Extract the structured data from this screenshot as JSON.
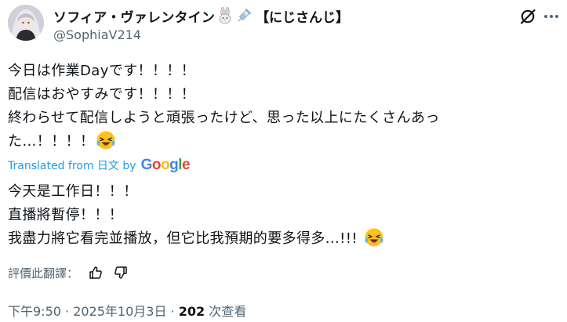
{
  "author": {
    "name": "ソフィア・ヴァレンタイン",
    "emoji_icons": [
      "rabbit-icon",
      "syringe-icon"
    ],
    "affiliation": "【にじさんじ】",
    "handle": "@SophiaV214"
  },
  "tweet": {
    "lines": [
      "今日は作業Dayです！！！！",
      "配信はおやすみです！！！！",
      "終わらせて配信しようと頑張ったけど、思った以上にたくさんあっ",
      "た…！！！！"
    ]
  },
  "translation": {
    "label": "Translated from 日文 by",
    "brand": "Google",
    "lines": [
      "今天是工作日！！！",
      "直播將暫停！！！",
      "我盡力將它看完並播放，但它比我預期的要多得多...!!!"
    ]
  },
  "rate": {
    "label": "評價此翻譯："
  },
  "meta": {
    "time": "下午9:50 · 2025年10月3日 · ",
    "views_count": "202",
    "views_label": " 次查看"
  },
  "colors": {
    "text": "#0f1419",
    "secondary": "#536471",
    "link": "#1d9bf0"
  }
}
